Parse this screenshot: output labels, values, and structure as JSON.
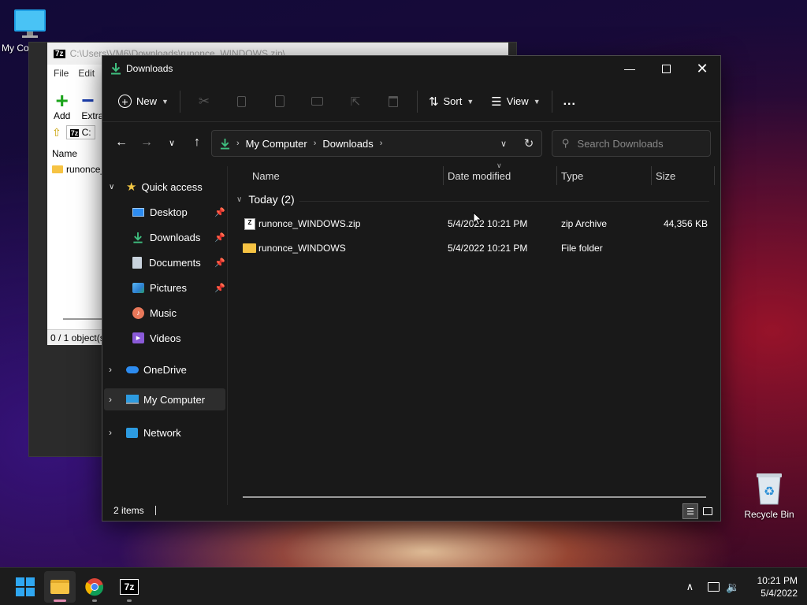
{
  "desktop": {
    "my_computer_label": "My Co",
    "recycle_bin_label": "Recycle Bin"
  },
  "zip_window": {
    "title": "C:\\Users\\VM6\\Downloads\\runonce_WINDOWS.zip\\",
    "menu": [
      "File",
      "Edit"
    ],
    "toolbar": [
      "Add",
      "Extra"
    ],
    "address": "C:",
    "column_name": "Name",
    "list_item": "runonce_",
    "status": "0 / 1 object(s"
  },
  "explorer": {
    "title": "Downloads",
    "commands": {
      "new": "New",
      "sort": "Sort",
      "view": "View",
      "more": "..."
    },
    "address": {
      "crumbs": [
        "My Computer",
        "Downloads"
      ]
    },
    "search": {
      "placeholder": "Search Downloads"
    },
    "sidebar": {
      "quick_access": "Quick access",
      "items": [
        {
          "label": "Desktop",
          "icon": "desktop-icon",
          "pinned": true
        },
        {
          "label": "Downloads",
          "icon": "download-icon",
          "pinned": true
        },
        {
          "label": "Documents",
          "icon": "documents-icon",
          "pinned": true
        },
        {
          "label": "Pictures",
          "icon": "pictures-icon",
          "pinned": true
        },
        {
          "label": "Music",
          "icon": "music-icon",
          "pinned": false
        },
        {
          "label": "Videos",
          "icon": "videos-icon",
          "pinned": false
        }
      ],
      "onedrive": "OneDrive",
      "my_computer": "My Computer",
      "network": "Network"
    },
    "columns": {
      "name": "Name",
      "date_modified": "Date modified",
      "type": "Type",
      "size": "Size"
    },
    "group": {
      "label": "Today (2)"
    },
    "files": [
      {
        "name": "runonce_WINDOWS.zip",
        "date": "5/4/2022 10:21 PM",
        "type": "zip Archive",
        "size": "44,356 KB",
        "icon": "zip-icon"
      },
      {
        "name": "runonce_WINDOWS",
        "date": "5/4/2022 10:21 PM",
        "type": "File folder",
        "size": "",
        "icon": "folder-icon"
      }
    ],
    "status": "2 items"
  },
  "taskbar": {
    "time": "10:21 PM",
    "date": "5/4/2022"
  },
  "colors": {
    "accent_folder": "#f6c343",
    "download_green": "#3fbf7f",
    "onedrive_blue": "#2d8cf0",
    "selection": "#2d2d2d"
  }
}
